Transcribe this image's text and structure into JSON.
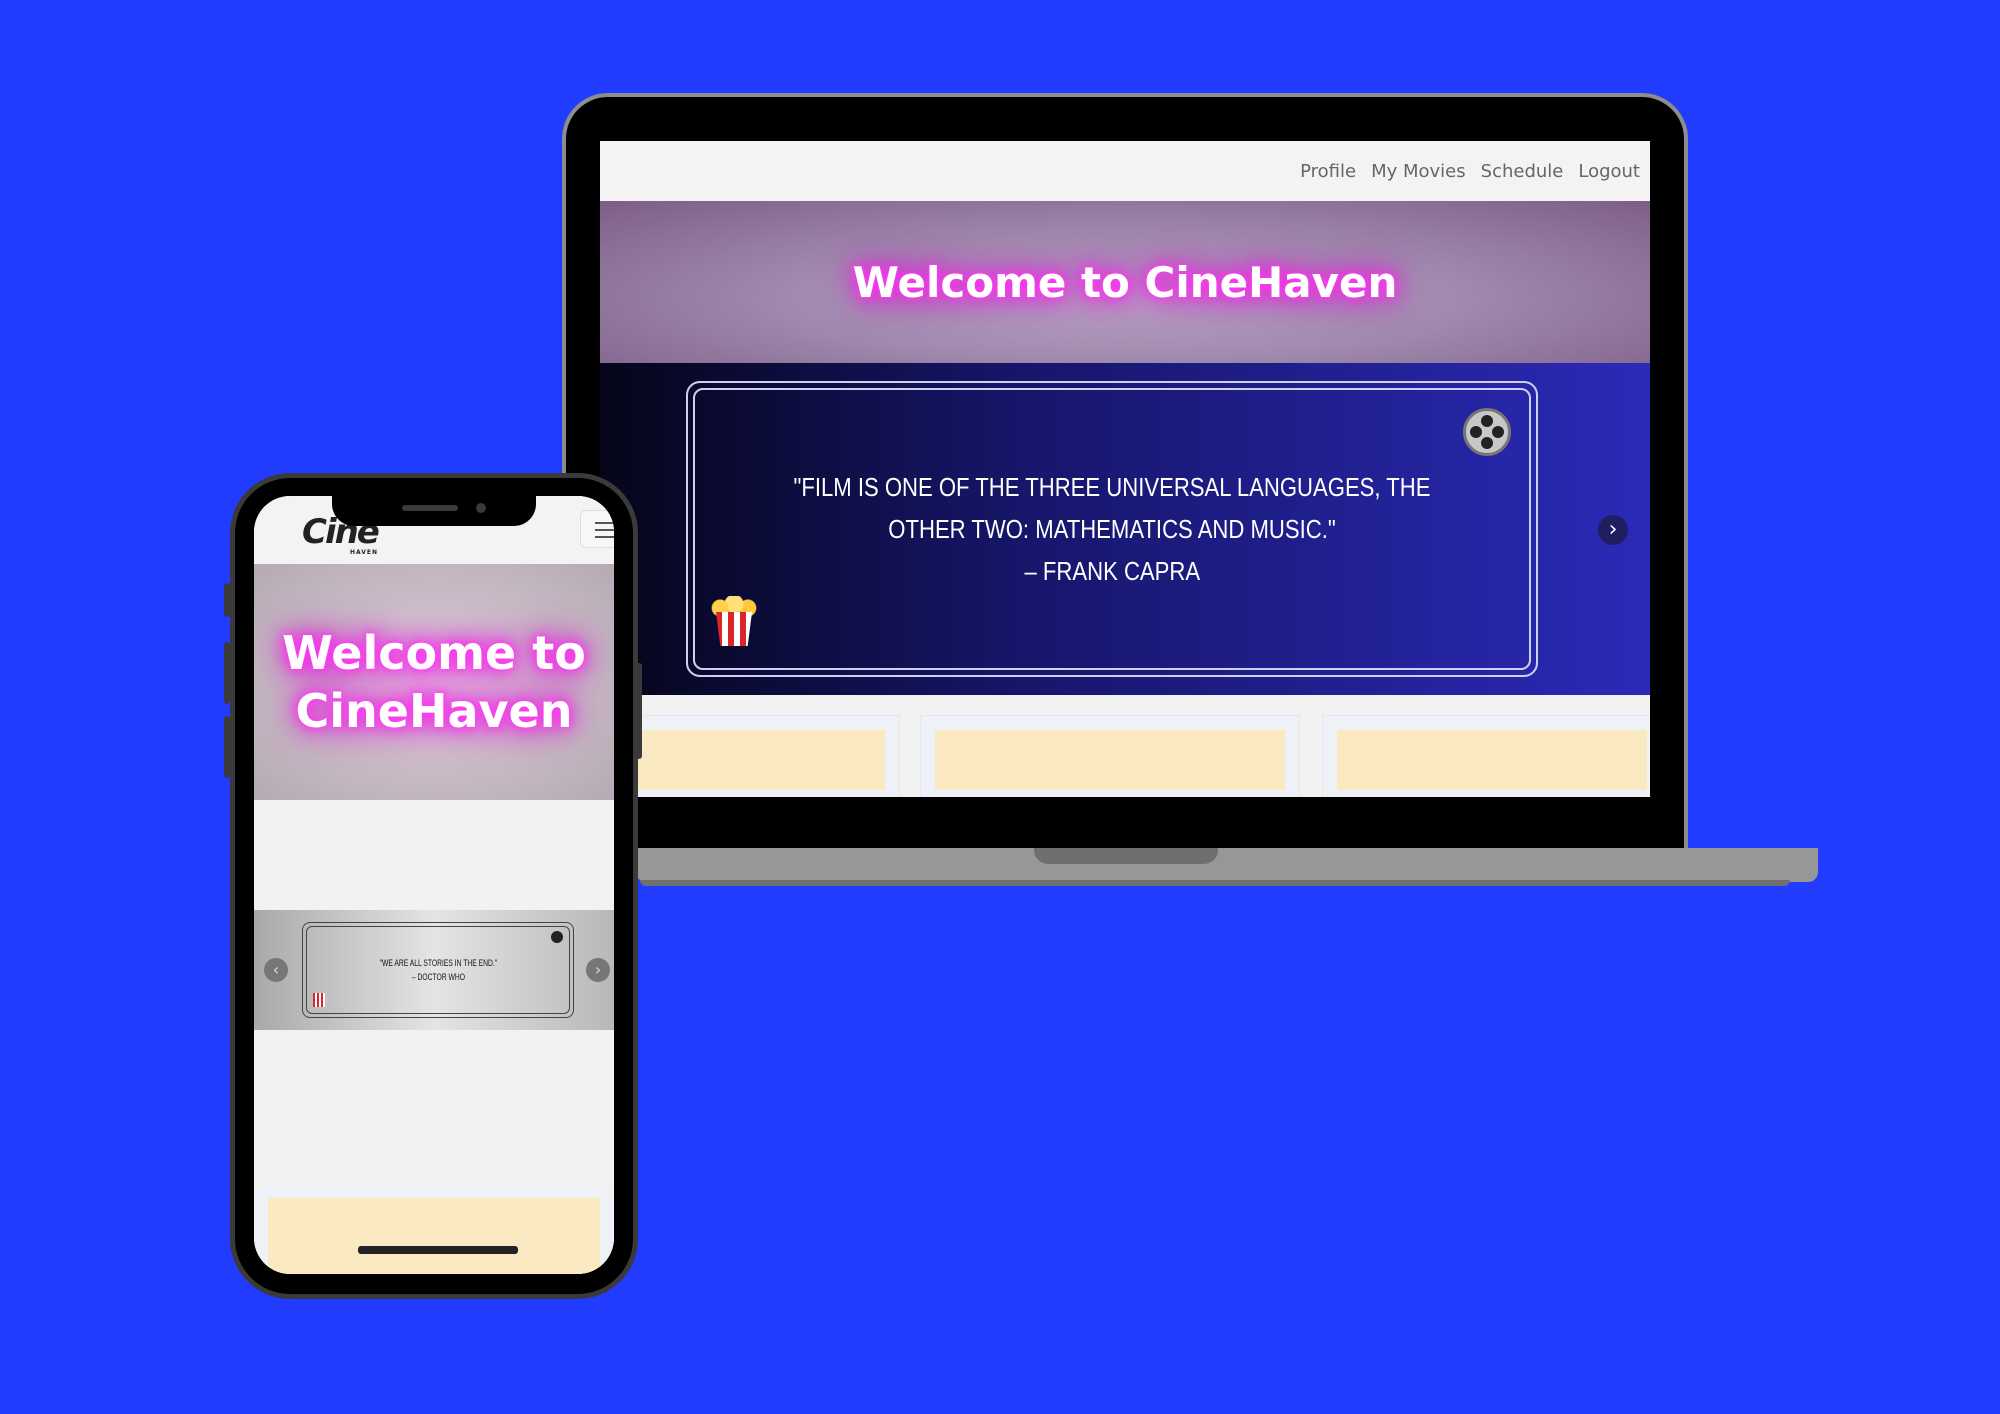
{
  "desktop": {
    "nav": [
      "Profile",
      "My Movies",
      "Schedule",
      "Logout"
    ],
    "hero_title": "Welcome to CineHaven",
    "quote": {
      "text": "\"Film is one of the three universal languages, the other two: mathematics and music.\"",
      "author": "– Frank Capra"
    },
    "next_arrow": "›"
  },
  "mobile": {
    "logo": "Cine",
    "logo_sub": "HAVEN",
    "hero_line1": "Welcome to",
    "hero_line2": "CineHaven",
    "quote": {
      "text": "\"We are all stories in the end.\"",
      "author": "– Doctor Who"
    },
    "prev_arrow": "‹",
    "next_arrow": "›"
  },
  "colors": {
    "background": "#223cff",
    "neon": "#ff2cf0",
    "card": "#fbe9c1"
  },
  "icons": [
    "film-reel-icon",
    "popcorn-icon",
    "hamburger-icon",
    "chevron-right-icon",
    "chevron-left-icon"
  ]
}
